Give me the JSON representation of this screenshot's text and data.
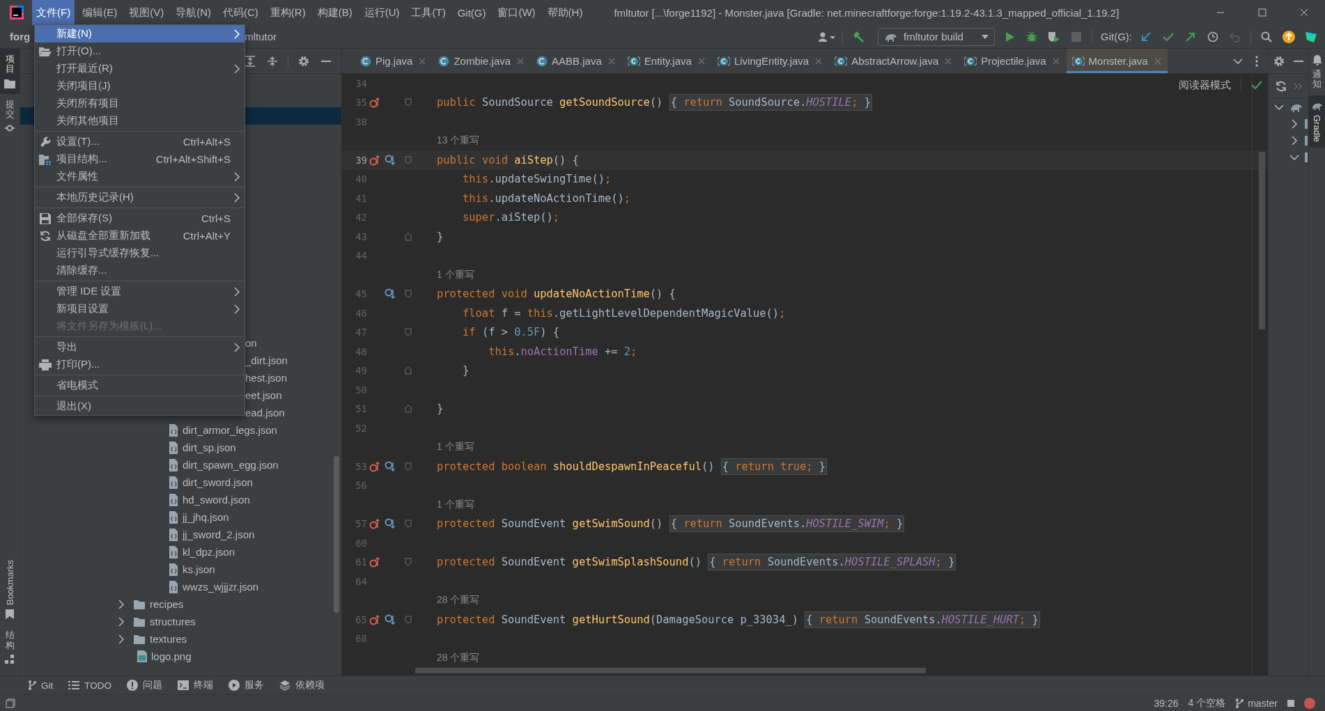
{
  "window": {
    "title": "fmltutor [...\\forge1192] - Monster.java [Gradle: net.minecraftforge:forge:1.19.2-43.1.3_mapped_official_1.19.2]"
  },
  "menu_bar": [
    {
      "label": "文件(F)",
      "selected": true
    },
    {
      "label": "编辑(E)",
      "selected": false
    },
    {
      "label": "视图(V)",
      "selected": false
    },
    {
      "label": "导航(N)",
      "selected": false
    },
    {
      "label": "代码(C)",
      "selected": false
    },
    {
      "label": "重构(R)",
      "selected": false
    },
    {
      "label": "构建(B)",
      "selected": false
    },
    {
      "label": "运行(U)",
      "selected": false
    },
    {
      "label": "工具(T)",
      "selected": false
    },
    {
      "label": "Git(G)",
      "selected": false
    },
    {
      "label": "窗口(W)",
      "selected": false
    },
    {
      "label": "帮助(H)",
      "selected": false
    }
  ],
  "navigation_bar": {
    "crumbs": [
      "forg",
      "mltutor"
    ],
    "run_configuration": "fmltutor build",
    "git_label": "Git(G):"
  },
  "left_tool_strip": [
    {
      "label": "项目",
      "selected": true
    },
    {
      "label": "提交",
      "selected": false
    },
    {
      "label": "Bookmarks",
      "selected": false
    },
    {
      "label": "结构",
      "selected": false
    }
  ],
  "project_tree": [
    {
      "kind": "covered",
      "selected": true
    },
    {
      "kind": "fragment",
      "label": "on",
      "selected": false
    },
    {
      "kind": "fragment",
      "label": "_dirt.json",
      "selected": false
    },
    {
      "kind": "fragment",
      "label": "hest.json",
      "selected": false
    },
    {
      "kind": "fragment",
      "label": "eet.json",
      "selected": false
    },
    {
      "kind": "fragment",
      "label": "ead.json",
      "selected": false
    },
    {
      "kind": "json",
      "label": "dirt_armor_legs.json",
      "selected": false
    },
    {
      "kind": "json",
      "label": "dirt_sp.json",
      "selected": false
    },
    {
      "kind": "json",
      "label": "dirt_spawn_egg.json",
      "selected": false
    },
    {
      "kind": "json",
      "label": "dirt_sword.json",
      "selected": false
    },
    {
      "kind": "json",
      "label": "hd_sword.json",
      "selected": false
    },
    {
      "kind": "json",
      "label": "jj_jhq.json",
      "selected": false
    },
    {
      "kind": "json",
      "label": "jj_sword_2.json",
      "selected": false
    },
    {
      "kind": "json",
      "label": "kl_dpz.json",
      "selected": false
    },
    {
      "kind": "json",
      "label": "ks.json",
      "selected": false
    },
    {
      "kind": "json",
      "label": "wwzs_wjjjzr.json",
      "selected": false
    },
    {
      "kind": "folder",
      "label": "recipes",
      "expanded": false,
      "selected": false
    },
    {
      "kind": "folder",
      "label": "structures",
      "expanded": false,
      "selected": false
    },
    {
      "kind": "folder",
      "label": "textures",
      "expanded": false,
      "selected": false
    },
    {
      "kind": "image",
      "label": "logo.png",
      "selected": false
    }
  ],
  "editor": {
    "tabs": [
      {
        "label": "Pig.java",
        "kind": "class",
        "selected": false
      },
      {
        "label": "Zombie.java",
        "kind": "class",
        "selected": false
      },
      {
        "label": "AABB.java",
        "kind": "class",
        "selected": false
      },
      {
        "label": "Entity.java",
        "kind": "abstract_class",
        "selected": false
      },
      {
        "label": "LivingEntity.java",
        "kind": "abstract_class",
        "selected": false
      },
      {
        "label": "AbstractArrow.java",
        "kind": "abstract_class",
        "selected": false
      },
      {
        "label": "Projectile.java",
        "kind": "abstract_class",
        "selected": false
      },
      {
        "label": "Monster.java",
        "kind": "abstract_class",
        "selected": true
      }
    ],
    "reader_mode": "阅读器模式",
    "lines": [
      {
        "kind": "code",
        "number": "34",
        "current": false,
        "overrides": false,
        "overridden": false,
        "fold_start": false,
        "fold_end": false
      },
      {
        "kind": "code",
        "number": "35",
        "current": false,
        "overrides": true,
        "overridden": false,
        "fold_start": true,
        "fold_end": false,
        "tokens": [
          {
            "kind": "keyword",
            "text": "public"
          },
          {
            "kind": "plain",
            "text": " SoundSource "
          },
          {
            "kind": "method",
            "text": "getSoundSource"
          },
          {
            "kind": "plain",
            "text": "() "
          },
          {
            "kind": "folded",
            "tokens": [
              {
                "kind": "plain",
                "text": "{ "
              },
              {
                "kind": "keyword",
                "text": "return"
              },
              {
                "kind": "plain",
                "text": " SoundSource."
              },
              {
                "kind": "constant",
                "text": "HOSTILE"
              },
              {
                "kind": "keyword",
                "text": ";"
              },
              {
                "kind": "plain",
                "text": " }"
              }
            ]
          }
        ]
      },
      {
        "kind": "code",
        "number": "38",
        "current": false,
        "overrides": false,
        "overridden": false,
        "fold_start": false,
        "fold_end": false
      },
      {
        "kind": "hint",
        "text": "13 个重写"
      },
      {
        "kind": "code",
        "number": "39",
        "current": true,
        "overrides": true,
        "overridden": true,
        "fold_start": true,
        "fold_end": false,
        "tokens": [
          {
            "kind": "keyword",
            "text": "public"
          },
          {
            "kind": "keyword",
            "text": " void"
          },
          {
            "kind": "method",
            "text": " aiStep"
          },
          {
            "kind": "plain",
            "text": "() {"
          }
        ]
      },
      {
        "kind": "code",
        "number": "40",
        "current": false,
        "overrides": false,
        "overridden": false,
        "fold_start": false,
        "fold_end": false,
        "tokens": [
          {
            "kind": "keyword",
            "text": "    this"
          },
          {
            "kind": "plain",
            "text": ".updateSwingTime()"
          },
          {
            "kind": "keyword",
            "text": ";"
          }
        ]
      },
      {
        "kind": "code",
        "number": "41",
        "current": false,
        "overrides": false,
        "overridden": false,
        "fold_start": false,
        "fold_end": false,
        "tokens": [
          {
            "kind": "keyword",
            "text": "    this"
          },
          {
            "kind": "plain",
            "text": ".updateNoActionTime()"
          },
          {
            "kind": "keyword",
            "text": ";"
          }
        ]
      },
      {
        "kind": "code",
        "number": "42",
        "current": false,
        "overrides": false,
        "overridden": false,
        "fold_start": false,
        "fold_end": false,
        "tokens": [
          {
            "kind": "keyword",
            "text": "    super"
          },
          {
            "kind": "plain",
            "text": ".aiStep()"
          },
          {
            "kind": "keyword",
            "text": ";"
          }
        ]
      },
      {
        "kind": "code",
        "number": "43",
        "current": false,
        "overrides": false,
        "overridden": false,
        "fold_start": false,
        "fold_end": true,
        "tokens": [
          {
            "kind": "plain",
            "text": "}"
          }
        ]
      },
      {
        "kind": "code",
        "number": "44",
        "current": false,
        "overrides": false,
        "overridden": false,
        "fold_start": false,
        "fold_end": false
      },
      {
        "kind": "hint",
        "text": "1 个重写"
      },
      {
        "kind": "code",
        "number": "45",
        "current": false,
        "overrides": false,
        "overridden": true,
        "fold_start": true,
        "fold_end": false,
        "tokens": [
          {
            "kind": "keyword",
            "text": "protected"
          },
          {
            "kind": "keyword",
            "text": " void"
          },
          {
            "kind": "method",
            "text": " updateNoActionTime"
          },
          {
            "kind": "plain",
            "text": "() {"
          }
        ]
      },
      {
        "kind": "code",
        "number": "46",
        "current": false,
        "overrides": false,
        "overridden": false,
        "fold_start": false,
        "fold_end": false,
        "tokens": [
          {
            "kind": "keyword",
            "text": "    float"
          },
          {
            "kind": "plain",
            "text": " f = "
          },
          {
            "kind": "keyword",
            "text": "this"
          },
          {
            "kind": "plain",
            "text": ".getLightLevelDependentMagicValue()"
          },
          {
            "kind": "keyword",
            "text": ";"
          }
        ]
      },
      {
        "kind": "code",
        "number": "47",
        "current": false,
        "overrides": false,
        "overridden": false,
        "fold_start": true,
        "fold_end": false,
        "tokens": [
          {
            "kind": "keyword",
            "text": "    if"
          },
          {
            "kind": "plain",
            "text": " (f > "
          },
          {
            "kind": "number",
            "text": "0.5F"
          },
          {
            "kind": "plain",
            "text": ") {"
          }
        ]
      },
      {
        "kind": "code",
        "number": "48",
        "current": false,
        "overrides": false,
        "overridden": false,
        "fold_start": false,
        "fold_end": false,
        "tokens": [
          {
            "kind": "keyword",
            "text": "        this"
          },
          {
            "kind": "plain",
            "text": "."
          },
          {
            "kind": "field",
            "text": "noActionTime"
          },
          {
            "kind": "plain",
            "text": " += "
          },
          {
            "kind": "number",
            "text": "2"
          },
          {
            "kind": "keyword",
            "text": ";"
          }
        ]
      },
      {
        "kind": "code",
        "number": "49",
        "current": false,
        "overrides": false,
        "overridden": false,
        "fold_start": false,
        "fold_end": true,
        "tokens": [
          {
            "kind": "plain",
            "text": "    }"
          }
        ]
      },
      {
        "kind": "code",
        "number": "50",
        "current": false,
        "overrides": false,
        "overridden": false,
        "fold_start": false,
        "fold_end": false
      },
      {
        "kind": "code",
        "number": "51",
        "current": false,
        "overrides": false,
        "overridden": false,
        "fold_start": false,
        "fold_end": true,
        "tokens": [
          {
            "kind": "plain",
            "text": "}"
          }
        ]
      },
      {
        "kind": "code",
        "number": "52",
        "current": false,
        "overrides": false,
        "overridden": false,
        "fold_start": false,
        "fold_end": false
      },
      {
        "kind": "hint",
        "text": "1 个重写"
      },
      {
        "kind": "code",
        "number": "53",
        "current": false,
        "overrides": true,
        "overridden": true,
        "fold_start": true,
        "fold_end": false,
        "tokens": [
          {
            "kind": "keyword",
            "text": "protected"
          },
          {
            "kind": "keyword",
            "text": " boolean"
          },
          {
            "kind": "method",
            "text": " shouldDespawnInPeaceful"
          },
          {
            "kind": "plain",
            "text": "() "
          },
          {
            "kind": "folded",
            "tokens": [
              {
                "kind": "plain",
                "text": "{ "
              },
              {
                "kind": "keyword",
                "text": "return"
              },
              {
                "kind": "keyword",
                "text": " true"
              },
              {
                "kind": "keyword",
                "text": ";"
              },
              {
                "kind": "plain",
                "text": " }"
              }
            ]
          }
        ]
      },
      {
        "kind": "code",
        "number": "56",
        "current": false,
        "overrides": false,
        "overridden": false,
        "fold_start": false,
        "fold_end": false
      },
      {
        "kind": "hint",
        "text": "1 个重写"
      },
      {
        "kind": "code",
        "number": "57",
        "current": false,
        "overrides": true,
        "overridden": true,
        "fold_start": true,
        "fold_end": false,
        "tokens": [
          {
            "kind": "keyword",
            "text": "protected"
          },
          {
            "kind": "plain",
            "text": " SoundEvent "
          },
          {
            "kind": "method",
            "text": "getSwimSound"
          },
          {
            "kind": "plain",
            "text": "() "
          },
          {
            "kind": "folded",
            "tokens": [
              {
                "kind": "plain",
                "text": "{ "
              },
              {
                "kind": "keyword",
                "text": "return"
              },
              {
                "kind": "plain",
                "text": " SoundEvents."
              },
              {
                "kind": "constant",
                "text": "HOSTILE_SWIM"
              },
              {
                "kind": "keyword",
                "text": ";"
              },
              {
                "kind": "plain",
                "text": " }"
              }
            ]
          }
        ]
      },
      {
        "kind": "code",
        "number": "60",
        "current": false,
        "overrides": false,
        "overridden": false,
        "fold_start": false,
        "fold_end": false
      },
      {
        "kind": "code",
        "number": "61",
        "current": false,
        "overrides": true,
        "overridden": false,
        "fold_start": true,
        "fold_end": false,
        "tokens": [
          {
            "kind": "keyword",
            "text": "protected"
          },
          {
            "kind": "plain",
            "text": " SoundEvent "
          },
          {
            "kind": "method",
            "text": "getSwimSplashSound"
          },
          {
            "kind": "plain",
            "text": "() "
          },
          {
            "kind": "folded",
            "tokens": [
              {
                "kind": "plain",
                "text": "{ "
              },
              {
                "kind": "keyword",
                "text": "return"
              },
              {
                "kind": "plain",
                "text": " SoundEvents."
              },
              {
                "kind": "constant",
                "text": "HOSTILE_SPLASH"
              },
              {
                "kind": "keyword",
                "text": ";"
              },
              {
                "kind": "plain",
                "text": " }"
              }
            ]
          }
        ]
      },
      {
        "kind": "code",
        "number": "64",
        "current": false,
        "overrides": false,
        "overridden": false,
        "fold_start": false,
        "fold_end": false
      },
      {
        "kind": "hint",
        "text": "28 个重写"
      },
      {
        "kind": "code",
        "number": "65",
        "current": false,
        "overrides": true,
        "overridden": true,
        "fold_start": true,
        "fold_end": false,
        "tokens": [
          {
            "kind": "keyword",
            "text": "protected"
          },
          {
            "kind": "plain",
            "text": " SoundEvent "
          },
          {
            "kind": "method",
            "text": "getHurtSound"
          },
          {
            "kind": "plain",
            "text": "(DamageSource p_33034_) "
          },
          {
            "kind": "folded",
            "tokens": [
              {
                "kind": "plain",
                "text": "{ "
              },
              {
                "kind": "keyword",
                "text": "return"
              },
              {
                "kind": "plain",
                "text": " SoundEvents."
              },
              {
                "kind": "constant",
                "text": "HOSTILE_HURT"
              },
              {
                "kind": "keyword",
                "text": ";"
              },
              {
                "kind": "plain",
                "text": " }"
              }
            ]
          }
        ]
      },
      {
        "kind": "code",
        "number": "68",
        "current": false,
        "overrides": false,
        "overridden": false,
        "fold_start": false,
        "fold_end": false
      },
      {
        "kind": "hint",
        "text": "28 个重写"
      }
    ]
  },
  "gradle_tree": [
    {
      "expanded": true,
      "children": [
        {
          "expanded": false
        },
        {
          "expanded": false
        },
        {
          "expanded": true
        }
      ]
    }
  ],
  "right_tool_strip": [
    {
      "label": "通知",
      "selected": false
    },
    {
      "label": "Gradle",
      "selected": true
    }
  ],
  "tool_windows": [
    {
      "label": "Git"
    },
    {
      "label": "TODO"
    },
    {
      "label": "问题"
    },
    {
      "label": "终端"
    },
    {
      "label": "服务"
    },
    {
      "label": "依赖项"
    }
  ],
  "status_bar": {
    "position": "39:26",
    "indent": "4 个空格",
    "branch": "master"
  },
  "file_menu": {
    "items": [
      {
        "kind": "item",
        "label": "新建(N)",
        "submenu": true,
        "selected": true,
        "disabled": false
      },
      {
        "kind": "item",
        "label": "打开(O)...",
        "submenu": false,
        "selected": false,
        "disabled": false
      },
      {
        "kind": "item",
        "label": "打开最近(R)",
        "submenu": true,
        "selected": false,
        "disabled": false
      },
      {
        "kind": "item",
        "label": "关闭项目(J)",
        "submenu": false,
        "selected": false,
        "disabled": false
      },
      {
        "kind": "item",
        "label": "关闭所有项目",
        "submenu": false,
        "selected": false,
        "disabled": false
      },
      {
        "kind": "item",
        "label": "关闭其他项目",
        "submenu": false,
        "selected": false,
        "disabled": false
      },
      {
        "kind": "separator"
      },
      {
        "kind": "item",
        "label": "设置(T)...",
        "shortcut": "Ctrl+Alt+S",
        "submenu": false,
        "selected": false,
        "disabled": false
      },
      {
        "kind": "item",
        "label": "项目结构...",
        "shortcut": "Ctrl+Alt+Shift+S",
        "submenu": false,
        "selected": false,
        "disabled": false
      },
      {
        "kind": "item",
        "label": "文件属性",
        "submenu": true,
        "selected": false,
        "disabled": false
      },
      {
        "kind": "separator"
      },
      {
        "kind": "item",
        "label": "本地历史记录(H)",
        "submenu": true,
        "selected": false,
        "disabled": false
      },
      {
        "kind": "separator"
      },
      {
        "kind": "item",
        "label": "全部保存(S)",
        "shortcut": "Ctrl+S",
        "submenu": false,
        "selected": false,
        "disabled": false
      },
      {
        "kind": "item",
        "label": "从磁盘全部重新加载",
        "shortcut": "Ctrl+Alt+Y",
        "submenu": false,
        "selected": false,
        "disabled": false
      },
      {
        "kind": "item",
        "label": "运行引导式缓存恢复...",
        "submenu": false,
        "selected": false,
        "disabled": false
      },
      {
        "kind": "item",
        "label": "清除缓存...",
        "submenu": false,
        "selected": false,
        "disabled": false
      },
      {
        "kind": "separator"
      },
      {
        "kind": "item",
        "label": "管理 IDE 设置",
        "submenu": true,
        "selected": false,
        "disabled": false
      },
      {
        "kind": "item",
        "label": "新项目设置",
        "submenu": true,
        "selected": false,
        "disabled": false
      },
      {
        "kind": "item",
        "label": "将文件另存为模板(L)...",
        "submenu": false,
        "selected": false,
        "disabled": true
      },
      {
        "kind": "separator"
      },
      {
        "kind": "item",
        "label": "导出",
        "submenu": true,
        "selected": false,
        "disabled": false
      },
      {
        "kind": "item",
        "label": "打印(P)...",
        "submenu": false,
        "selected": false,
        "disabled": false
      },
      {
        "kind": "separator"
      },
      {
        "kind": "item",
        "label": "省电模式",
        "submenu": false,
        "selected": false,
        "disabled": false
      },
      {
        "kind": "separator"
      },
      {
        "kind": "item",
        "label": "退出(X)",
        "submenu": false,
        "selected": false,
        "disabled": false
      }
    ]
  }
}
